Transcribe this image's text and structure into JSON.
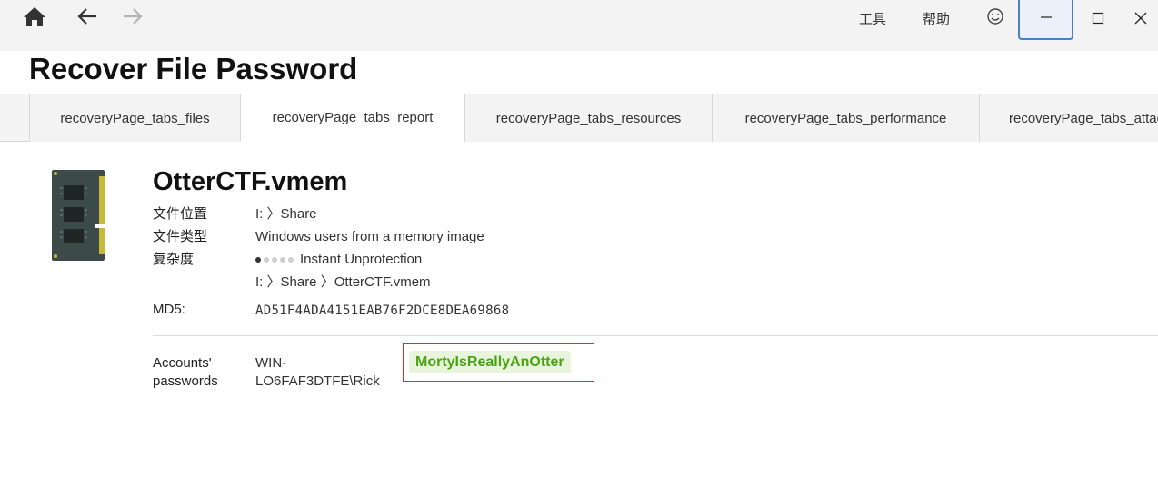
{
  "toolbar": {
    "home_icon": "home-icon",
    "back_icon": "arrow-left-icon",
    "forward_icon": "arrow-right-icon",
    "menu": [
      "工具",
      "帮助"
    ],
    "feedback_icon": "smiley-icon",
    "window_controls": [
      "minimize-icon",
      "maximize-icon",
      "close-icon"
    ]
  },
  "page": {
    "title": "Recover File Password"
  },
  "tabs": [
    {
      "label": "recoveryPage_tabs_files",
      "selected": false
    },
    {
      "label": "recoveryPage_tabs_report",
      "selected": true
    },
    {
      "label": "recoveryPage_tabs_resources",
      "selected": false
    },
    {
      "label": "recoveryPage_tabs_performance",
      "selected": false
    },
    {
      "label": "recoveryPage_tabs_attacks",
      "selected": false
    }
  ],
  "file": {
    "icon": "memory-module-icon",
    "name": "OtterCTF.vmem",
    "location_label": "文件位置",
    "location_value": "I: 〉Share",
    "type_label": "文件类型",
    "type_value": "Windows users from a memory image",
    "complexity_label": "复杂度",
    "complexity_level": 1,
    "complexity_max": 5,
    "complexity_value": "Instant Unprotection",
    "path_value": "I: 〉Share 〉OtterCTF.vmem",
    "md5_label": "MD5:",
    "md5_value": "AD51F4ADA4151EAB76F2DCE8DEA69868"
  },
  "accounts": {
    "label_line1": "Accounts'",
    "label_line2": "passwords",
    "user_line1": "WIN-",
    "user_line2": "LO6FAF3DTFE\\Rick",
    "password": "MortyIsReallyAnOtter"
  },
  "colors": {
    "accent": "#4a7fc1",
    "password_text": "#4aa312",
    "password_bg": "#e8f5dc",
    "highlight_border": "#d9302c"
  }
}
